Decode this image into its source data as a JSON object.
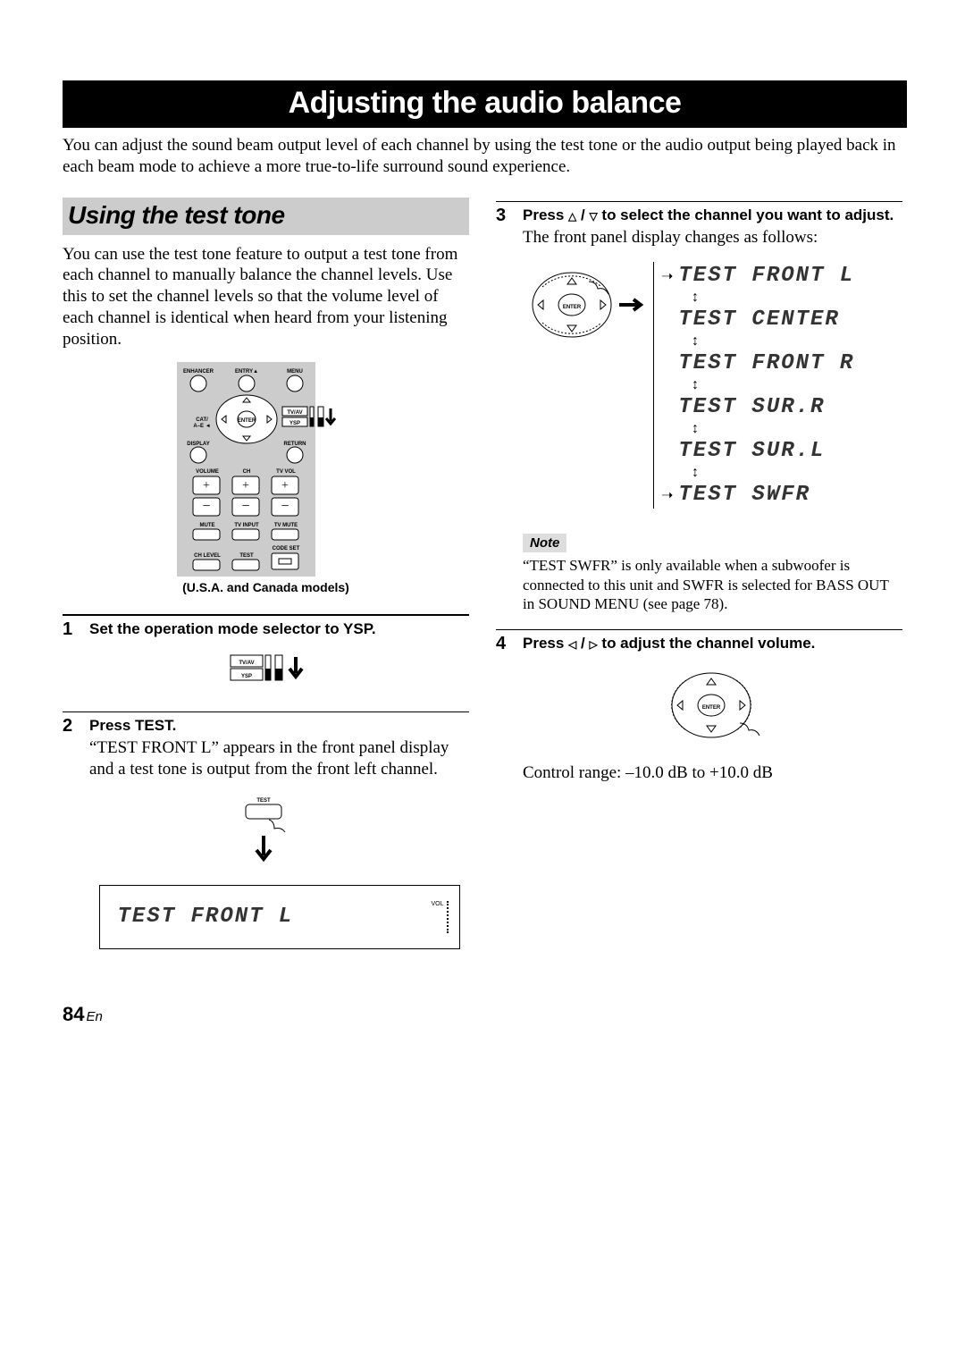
{
  "banner_title": "Adjusting the audio balance",
  "intro": "You can adjust the sound beam output level of each channel by using the test tone or the audio output being played back in each beam mode to achieve a more true-to-life surround sound experience.",
  "section_title": "Using the test tone",
  "testtone_intro": "You can use the test tone feature to output a test tone from each channel to manually balance the channel levels. Use this to set the channel levels so that the volume level of each channel is identical when heard from your listening position.",
  "remote": {
    "rows": {
      "top": {
        "left": "ENHANCER",
        "mid": "ENTRY",
        "right": "MENU"
      },
      "pad": {
        "left": "CAT/\nA–E",
        "center": "ENTER",
        "rightTop": "TV/AV",
        "rightBot": "YSP"
      },
      "mid": {
        "left": "DISPLAY",
        "right": "RETURN"
      },
      "vol": {
        "c1": "VOLUME",
        "c2": "CH",
        "c3": "TV VOL"
      },
      "mute": {
        "c1": "MUTE",
        "c2": "TV INPUT",
        "c3": "TV MUTE"
      },
      "bot": {
        "c1": "CH LEVEL",
        "c2": "TEST",
        "c3": "CODE SET"
      }
    },
    "caption": "(U.S.A. and Canada models)"
  },
  "steps": {
    "s1": {
      "num": "1",
      "bold": "Set the operation mode selector to YSP.",
      "selector": {
        "top": "TV/AV",
        "bot": "YSP"
      }
    },
    "s2": {
      "num": "2",
      "bold": "Press TEST.",
      "body": "“TEST FRONT L” appears in the front panel display and a test tone is output from the front left channel.",
      "btn_label": "TEST",
      "panel_text": "TEST FRONT L",
      "vol": "VOL"
    },
    "s3": {
      "num": "3",
      "bold_pre": "Press ",
      "bold_post": " to select the channel you want to adjust.",
      "body": "The front panel display changes as follows:",
      "enter": "ENTER",
      "sequence": [
        "TEST FRONT L",
        "TEST CENTER",
        "TEST FRONT R",
        "TEST SUR.R",
        "TEST SUR.L",
        "TEST SWFR"
      ]
    },
    "s4": {
      "num": "4",
      "bold_pre": "Press ",
      "bold_post": " to adjust the channel volume.",
      "enter": "ENTER",
      "range": "Control range: –10.0 dB to +10.0 dB"
    }
  },
  "note": {
    "label": "Note",
    "text": "“TEST SWFR” is only available when a subwoofer is connected to this unit and SWFR is selected for BASS OUT in SOUND MENU (see page 78)."
  },
  "footer": {
    "page": "84",
    "lang": "En"
  }
}
